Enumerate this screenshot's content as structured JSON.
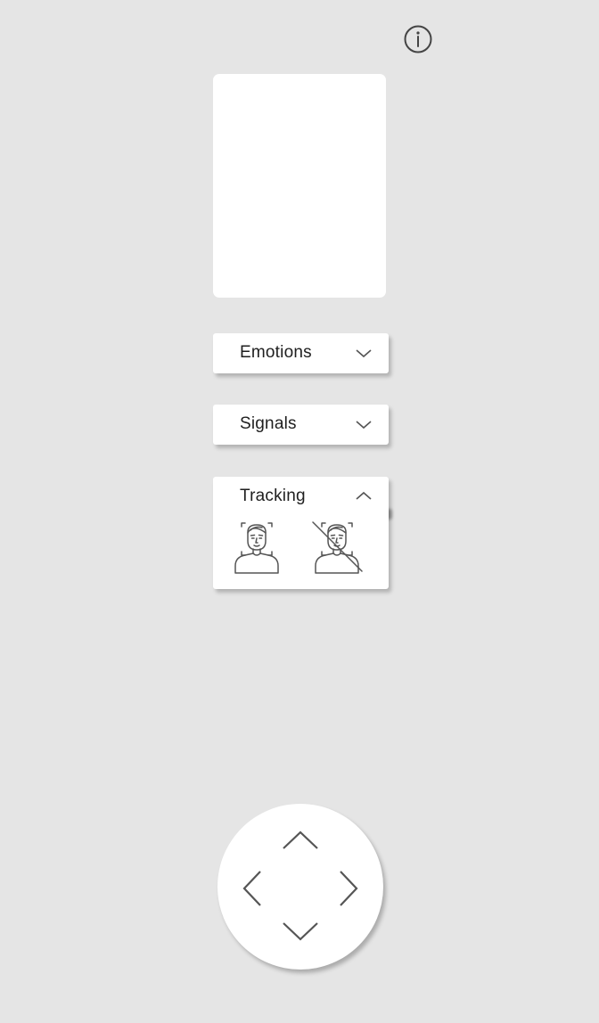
{
  "colors": {
    "background": "#e5e5e5",
    "panel": "#ffffff",
    "text": "#1f1f1f",
    "icon_stroke": "#555555"
  },
  "header": {
    "info_icon": "info-circle-icon"
  },
  "preview": {},
  "panels": {
    "emotions": {
      "label": "Emotions",
      "state": "collapsed",
      "icon": "chevron-down-icon"
    },
    "signals": {
      "label": "Signals",
      "state": "collapsed",
      "icon": "chevron-down-icon"
    },
    "tracking": {
      "label": "Tracking",
      "state": "expanded",
      "icon": "chevron-up-icon",
      "options": [
        {
          "id": "tracking-on",
          "icon": "face-tracking-icon"
        },
        {
          "id": "tracking-off",
          "icon": "face-tracking-off-icon"
        }
      ]
    }
  },
  "dpad": {
    "up_icon": "chevron-up-icon",
    "down_icon": "chevron-down-icon",
    "left_icon": "chevron-left-icon",
    "right_icon": "chevron-right-icon"
  }
}
